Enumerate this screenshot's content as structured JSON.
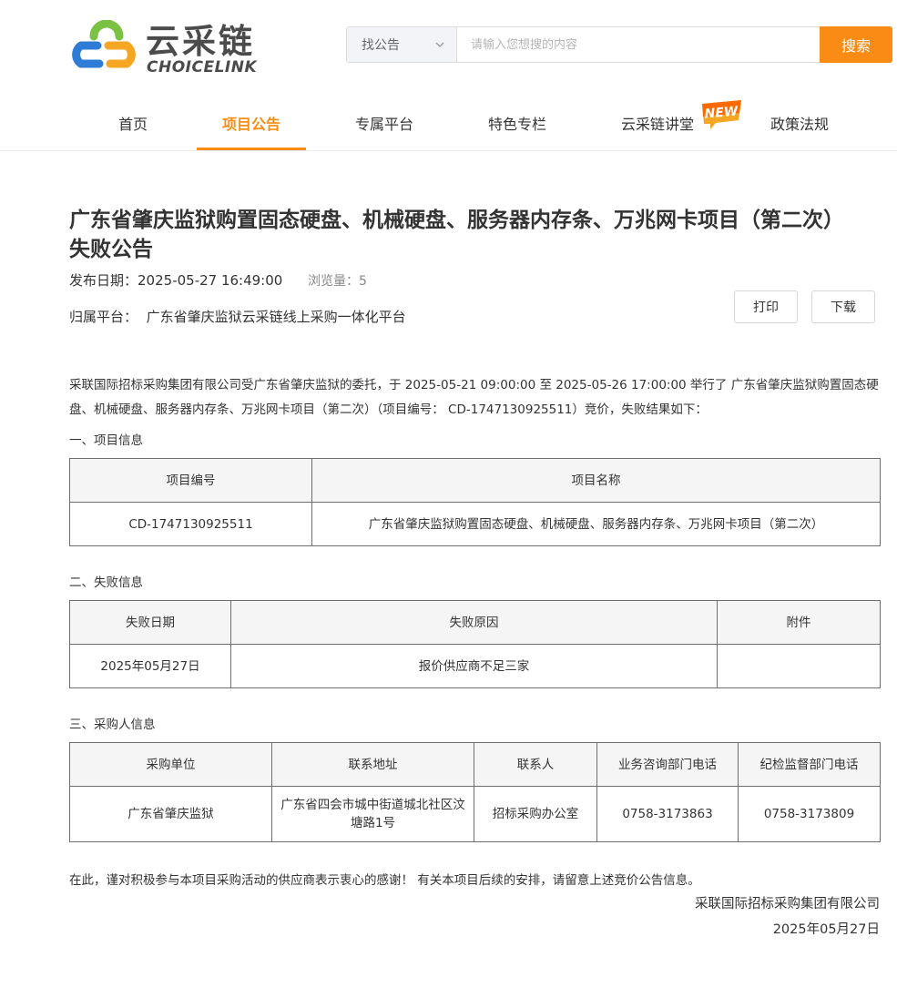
{
  "header": {
    "logo_cn": "云采链",
    "logo_en": "CHOICELINK",
    "search": {
      "type_label": "找公告",
      "placeholder": "请输入您想搜的内容",
      "button_label": "搜索"
    }
  },
  "nav": {
    "items": [
      {
        "label": "首页"
      },
      {
        "label": "项目公告"
      },
      {
        "label": "专属平台"
      },
      {
        "label": "特色专栏"
      },
      {
        "label": "云采链讲堂"
      },
      {
        "label": "政策法规"
      }
    ],
    "active_index": 1,
    "badge": "NEW"
  },
  "article": {
    "title": "广东省肇庆监狱购置固态硬盘、机械硬盘、服务器内存条、万兆网卡项目（第二次）失败公告",
    "publish_date_label": "发布日期：",
    "publish_date": "2025-05-27 16:49:00",
    "views_label": "浏览量：",
    "views": "5",
    "platform_label": "归属平台：",
    "platform": "广东省肇庆监狱云采链线上采购一体化平台",
    "print_label": "打印",
    "download_label": "下载",
    "intro": "采联国际招标采购集团有限公司受广东省肇庆监狱的委托，于 2025-05-21 09:00:00 至 2025-05-26 17:00:00 举行了 广东省肇庆监狱购置固态硬盘、机械硬盘、服务器内存条、万兆网卡项目（第二次）（项目编号： CD-1747130925511）竞价，失败结果如下：",
    "section1": {
      "heading": "一、项目信息",
      "headers": [
        "项目编号",
        "项目名称"
      ],
      "row": [
        "CD-1747130925511",
        "广东省肇庆监狱购置固态硬盘、机械硬盘、服务器内存条、万兆网卡项目（第二次）"
      ]
    },
    "section2": {
      "heading": "二、失败信息",
      "headers": [
        "失败日期",
        "失败原因",
        "附件"
      ],
      "row": [
        "2025年05月27日",
        "报价供应商不足三家",
        ""
      ]
    },
    "section3": {
      "heading": "三、采购人信息",
      "headers": [
        "采购单位",
        "联系地址",
        "联系人",
        "业务咨询部门电话",
        "纪检监督部门电话"
      ],
      "row": [
        "广东省肇庆监狱",
        "广东省四会市城中街道城北社区汶塘路1号",
        "招标采购办公室",
        "0758-3173863",
        "0758-3173809"
      ]
    },
    "closing": "在此，谨对积极参与本项目采购活动的供应商表示衷心的感谢！ 有关本项目后续的安排，请留意上述竞价公告信息。",
    "signature": "采联国际招标采购集团有限公司",
    "sign_date": "2025年05月27日"
  },
  "colors": {
    "accent": "#fa8c16",
    "logo_green": "#7bc142",
    "logo_blue": "#2e7cd6",
    "logo_orange": "#f5a623"
  }
}
